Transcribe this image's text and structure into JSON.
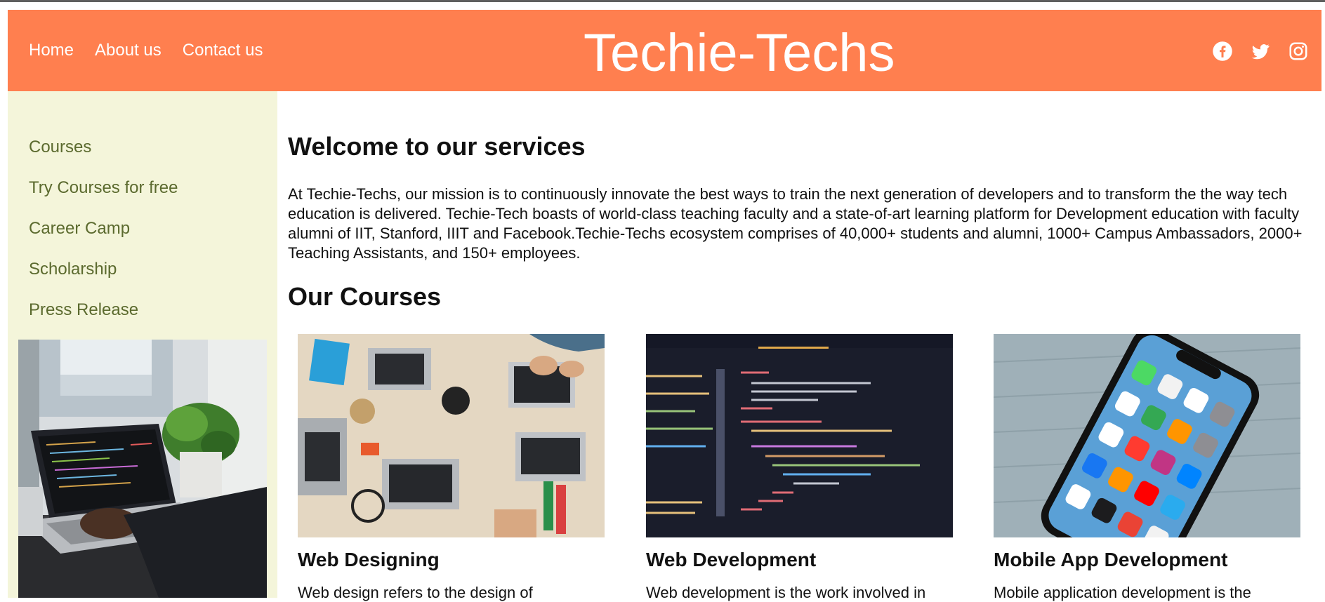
{
  "header": {
    "nav": [
      "Home",
      "About us",
      "Contact us"
    ],
    "brand": "Techie-Techs",
    "social_icons": [
      "facebook-icon",
      "twitter-icon",
      "instagram-icon"
    ]
  },
  "sidebar": {
    "items": [
      "Courses",
      "Try Courses for free",
      "Career Camp",
      "Scholarship",
      "Press Release"
    ]
  },
  "main": {
    "welcome_heading": "Welcome to our services",
    "mission_text": "At Techie-Techs, our mission is to continuously innovate the best ways to train the next generation of developers and to transform the the way tech education is delivered. Techie-Tech boasts of world-class teaching faculty and a state-of-art learning platform for Development education with faculty alumni of IIT, Stanford, IIIT and Facebook.Techie-Techs ecosystem comprises of 40,000+ students and alumni, 1000+ Campus Ambassadors, 2000+ Teaching Assistants, and 150+ employees.",
    "courses_heading": "Our Courses",
    "courses": [
      {
        "title": "Web Designing",
        "description": "Web design refers to the design of"
      },
      {
        "title": "Web Development",
        "description": "Web development is the work involved in"
      },
      {
        "title": "Mobile App Development",
        "description": "Mobile application development is the"
      }
    ]
  },
  "colors": {
    "header_bg": "#ff7f4f",
    "sidebar_bg": "#f4f5da",
    "sidebar_link": "#5b6a2e"
  }
}
